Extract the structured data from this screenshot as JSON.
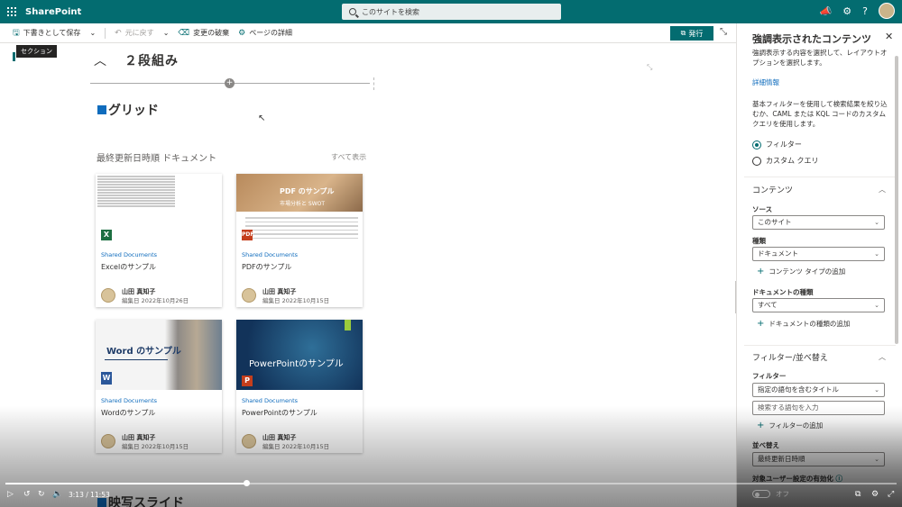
{
  "suite": {
    "app_title": "SharePoint",
    "search_placeholder": "このサイトを検索"
  },
  "toolbar": {
    "save_draft": "下書きとして保存",
    "undo": "元に戻す",
    "discard": "変更の破棄",
    "page_details": "ページの詳細",
    "publish": "発行"
  },
  "canvas": {
    "section_tag": "セクション",
    "section_title": "２段組み",
    "grid_title": "グリッド",
    "docs_heading": "最終更新日時順 ドキュメント",
    "see_all": "すべて表示",
    "bottom_title": "映写スライド"
  },
  "cards": [
    {
      "site": "Shared Documents",
      "name": "Excelのサンプル",
      "author": "山田 真知子",
      "edited": "編集日 2022年10月26日"
    },
    {
      "site": "Shared Documents",
      "name": "PDFのサンプル",
      "author": "山田 真知子",
      "edited": "編集日 2022年10月15日",
      "thumb_title": "PDF のサンプル",
      "thumb_sub": "市場分析と SWOT"
    },
    {
      "site": "Shared Documents",
      "name": "Wordのサンプル",
      "author": "山田 真知子",
      "edited": "編集日 2022年10月15日",
      "thumb_title": "Word のサンプル"
    },
    {
      "site": "Shared Documents",
      "name": "PowerPointのサンプル",
      "author": "山田 真知子",
      "edited": "編集日 2022年10月15日",
      "thumb_title": "PowerPointのサンプル"
    }
  ],
  "video": {
    "time": "3:13 / 11:53",
    "progress": 0.27
  },
  "panel": {
    "title": "強調表示されたコンテンツ",
    "desc": "強調表示する内容を選択して、レイアウトオプションを選択します。",
    "link": "詳細情報",
    "help": "基本フィルターを使用して検索結果を絞り込むか、CAML または KQL コードのカスタムクエリを使用します。",
    "radio_filter": "フィルター",
    "radio_custom": "カスタム クエリ",
    "content_head": "コンテンツ",
    "source_label": "ソース",
    "source_value": "このサイト",
    "type_label": "種類",
    "type_value": "ドキュメント",
    "add_content_type": "コンテンツ タイプの追加",
    "doctype_label": "ドキュメントの種類",
    "doctype_value": "すべて",
    "add_doctype": "ドキュメントの種類の追加",
    "filter_sort_head": "フィルター/並べ替え",
    "filter_label": "フィルター",
    "filter_value": "指定の語句を含むタイトル",
    "filter_input_placeholder": "検索する語句を入力",
    "add_filter": "フィルターの追加",
    "sort_label": "並べ替え",
    "sort_value": "最終更新日時順",
    "audience_label": "対象ユーザー設定の有効化",
    "toggle_off": "オフ"
  }
}
